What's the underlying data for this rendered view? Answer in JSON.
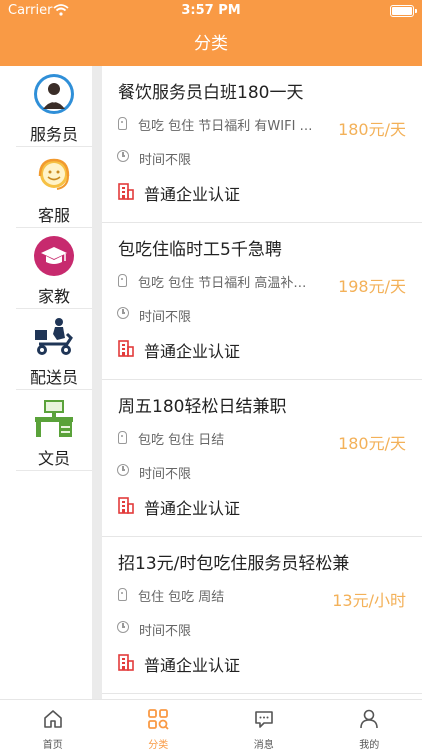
{
  "status_bar": {
    "carrier": "Carrier",
    "time": "3:57 PM"
  },
  "nav": {
    "title": "分类"
  },
  "categories": [
    {
      "label": "服务员",
      "icon": "waiter-icon"
    },
    {
      "label": "客服",
      "icon": "customer-service-icon"
    },
    {
      "label": "家教",
      "icon": "graduation-cap-icon"
    },
    {
      "label": "配送员",
      "icon": "delivery-scooter-icon"
    },
    {
      "label": "文员",
      "icon": "office-desk-icon"
    }
  ],
  "jobs": [
    {
      "title": "餐饮服务员白班180一天",
      "tags": "包吃 包住 节日福利 有WIFI 有wifi",
      "salary": "180元/天",
      "time": "时间不限",
      "cert": "普通企业认证"
    },
    {
      "title": "包吃住临时工5千急聘",
      "tags": "包吃 包住 节日福利 高温补贴 交通补贴",
      "salary": "198元/天",
      "time": "时间不限",
      "cert": "普通企业认证"
    },
    {
      "title": "周五180轻松日结兼职",
      "tags": "包吃 包住 日结",
      "salary": "180元/天",
      "time": "时间不限",
      "cert": "普通企业认证"
    },
    {
      "title": "招13元/时包吃住服务员轻松兼",
      "tags": "包住 包吃 周结",
      "salary": "13元/小时",
      "time": "时间不限",
      "cert": "普通企业认证"
    }
  ],
  "tabs": [
    {
      "label": "首页",
      "icon": "home-icon",
      "active": false
    },
    {
      "label": "分类",
      "icon": "category-grid-icon",
      "active": true
    },
    {
      "label": "消息",
      "icon": "message-icon",
      "active": false
    },
    {
      "label": "我的",
      "icon": "profile-icon",
      "active": false
    }
  ],
  "colors": {
    "brand": "#f99a45",
    "salary": "#f3b159",
    "cert_red": "#e23b3b"
  }
}
